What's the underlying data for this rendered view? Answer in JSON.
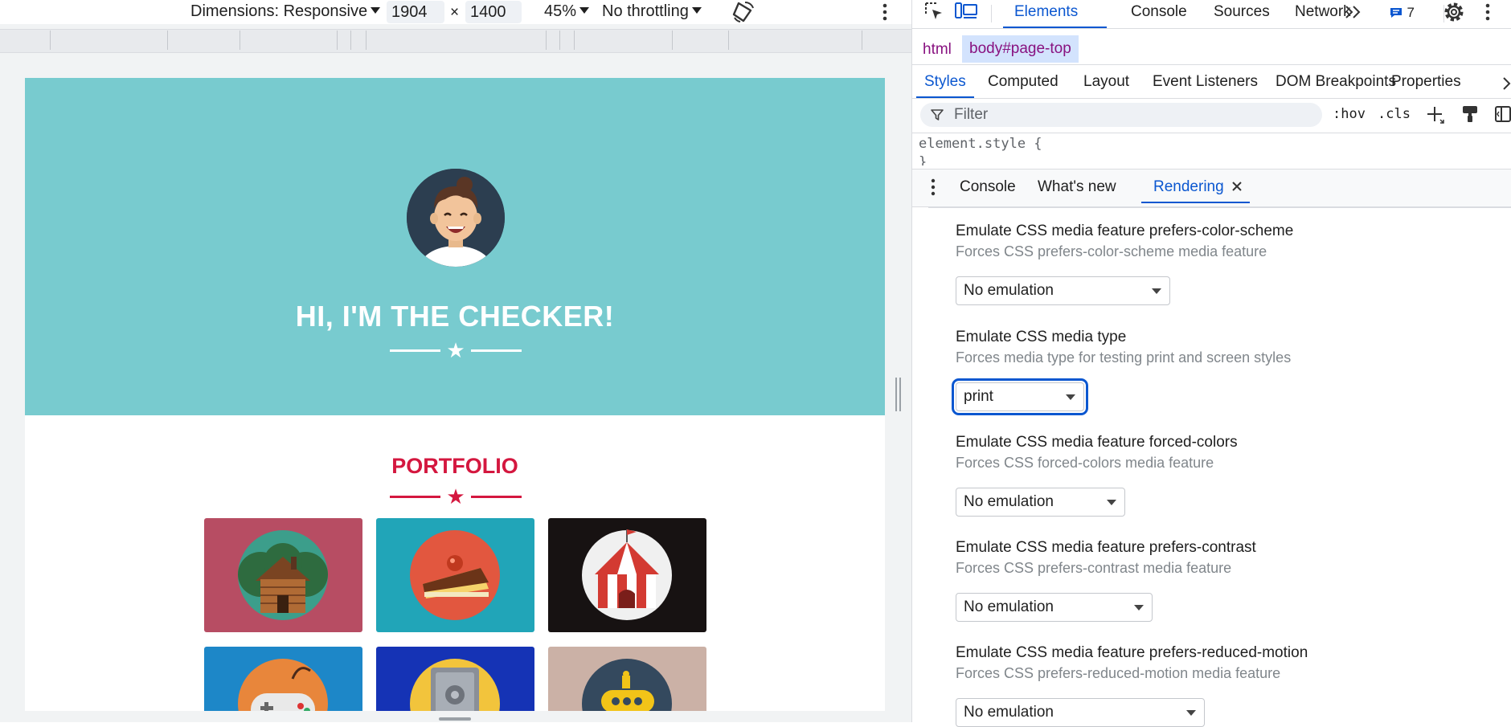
{
  "device_toolbar": {
    "dimensions_label": "Dimensions: Responsive",
    "width_value": "1904",
    "times_sign": "×",
    "height_value": "1400",
    "zoom_label": "45%",
    "throttling_label": "No throttling"
  },
  "site": {
    "hero_title": "HI, I'M THE CHECKER!",
    "portfolio_title": "PORTFOLIO",
    "colors": {
      "masthead": "#78cbcf",
      "accent": "#d4173f"
    },
    "tiles": [
      {
        "name": "cabin",
        "bg": "#b74d63"
      },
      {
        "name": "cake",
        "bg": "#21a5b8"
      },
      {
        "name": "circus",
        "bg": "#171212"
      },
      {
        "name": "game-controller",
        "bg": "#1d87c8"
      },
      {
        "name": "safe",
        "bg": "#1533b5"
      },
      {
        "name": "submarine",
        "bg": "#cbb1a6"
      }
    ]
  },
  "devtools": {
    "main_tabs": [
      "Elements",
      "Console",
      "Sources",
      "Network"
    ],
    "active_main_tab": "Elements",
    "issues_count": "7",
    "breadcrumbs": [
      "html",
      "body#page-top"
    ],
    "sub_tabs": [
      "Styles",
      "Computed",
      "Layout",
      "Event Listeners",
      "DOM Breakpoints",
      "Properties"
    ],
    "active_sub_tab": "Styles",
    "filter_placeholder": "Filter",
    "hov_label": ":hov",
    "cls_label": ".cls",
    "element_style_open": "element.style {",
    "element_style_close": "}",
    "drawer_tabs": [
      "Console",
      "What's new",
      "Rendering"
    ],
    "active_drawer_tab": "Rendering",
    "rendering": [
      {
        "title": "Emulate CSS media feature prefers-color-scheme",
        "desc": "Forces CSS prefers-color-scheme media feature",
        "value": "No emulation"
      },
      {
        "title": "Emulate CSS media type",
        "desc": "Forces media type for testing print and screen styles",
        "value": "print"
      },
      {
        "title": "Emulate CSS media feature forced-colors",
        "desc": "Forces CSS forced-colors media feature",
        "value": "No emulation"
      },
      {
        "title": "Emulate CSS media feature prefers-contrast",
        "desc": "Forces CSS prefers-contrast media feature",
        "value": "No emulation"
      },
      {
        "title": "Emulate CSS media feature prefers-reduced-motion",
        "desc": "Forces CSS prefers-reduced-motion media feature",
        "value": "No emulation"
      }
    ]
  }
}
